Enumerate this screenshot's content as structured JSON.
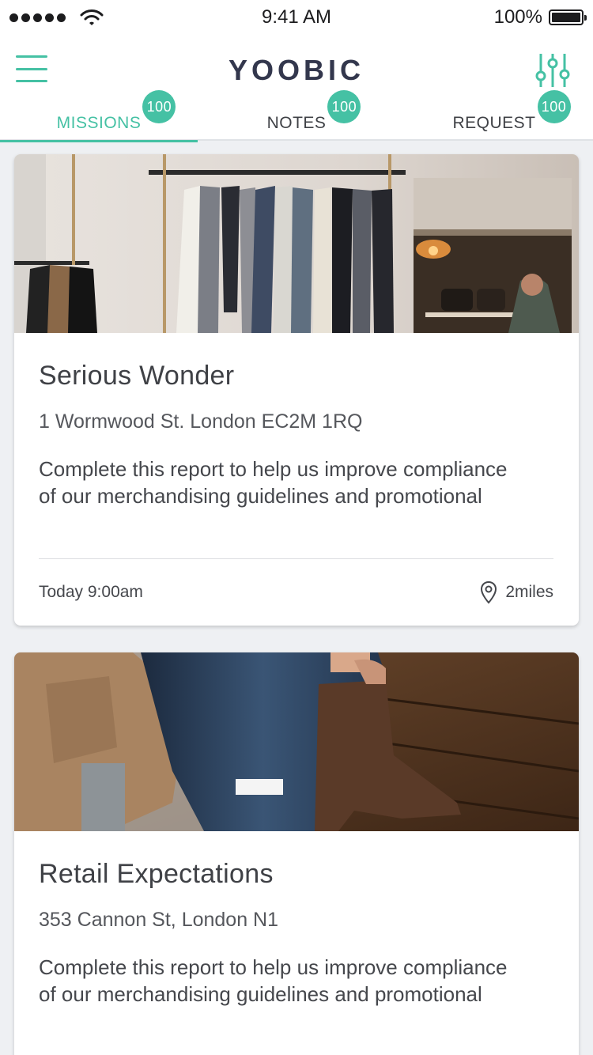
{
  "status_bar": {
    "time": "9:41 AM",
    "battery": "100%",
    "battery_level": 1.0
  },
  "header": {
    "logo": "YOOBIC"
  },
  "tabs": [
    {
      "label": "MISSIONS",
      "badge": "100",
      "active": true
    },
    {
      "label": "NOTES",
      "badge": "100",
      "active": false
    },
    {
      "label": "REQUEST",
      "badge": "100",
      "active": false
    }
  ],
  "missions": [
    {
      "title": "Serious Wonder",
      "address": "1 Wormwood St. London EC2M 1RQ",
      "description": "Complete this report to help us improve compliance\nof our merchandising guidelines and promotional",
      "time": "Today 9:00am",
      "distance": "2miles"
    },
    {
      "title": "Retail Expectations",
      "address": "353 Cannon St, London N1",
      "description": "Complete this report to help us improve compliance\nof our merchandising guidelines and promotional"
    }
  ],
  "colors": {
    "accent": "#45c1a4",
    "logo": "#33374d",
    "background": "#eef0f3"
  },
  "icons": {
    "menu": "hamburger-icon",
    "filter": "sliders-icon",
    "location": "map-pin-icon"
  }
}
